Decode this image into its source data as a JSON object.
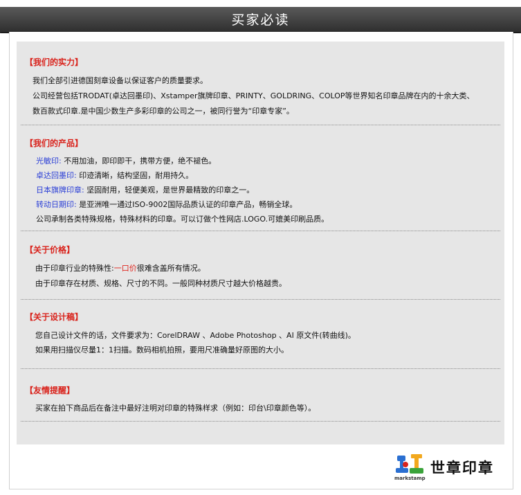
{
  "header": {
    "title": "买家必读"
  },
  "sections": {
    "strength": {
      "title": "【我们的实力】",
      "lines": [
        "我们全部引进德国刻章设备以保证客户的质量要求。",
        "公司经营包括TRODAT(卓达回墨印)、Xstamper旗牌印章、PRINTY、GOLDRING、COLOP等世界知名印章品牌在内的十余大类、",
        "数百款式印章.是中国少数生产多彩印章的公司之一，被同行誉为“印章专家”。"
      ]
    },
    "products": {
      "title": "【我们的产品】",
      "items": [
        {
          "name": "光敏印:",
          "desc": "不用加油，即印即干，携带方便，绝不褪色。"
        },
        {
          "name": "卓达回墨印:",
          "desc": "印迹清晰，结构坚固，耐用持久。"
        },
        {
          "name": "日本旗牌印章:",
          "desc": "坚固耐用，轻便美观，是世界最精致的印章之一。"
        },
        {
          "name": "转动日期印:",
          "desc": "是亚洲唯一通过ISO-9002国际品质认证的印章产品，畅销全球。"
        }
      ],
      "note": "公司承制各类特殊规格，特殊材料的印章。可以订做个性网店.LOGO.可媲美印刷品质。"
    },
    "price": {
      "title": "【关于价格】",
      "line1_pre": "由于印章行业的特殊性:",
      "line1_highlight": "一口价",
      "line1_post": "很难含盖所有情况。",
      "line2": "由于印章存在材质、规格、尺寸的不同。一般同种材质尺寸越大价格越贵。"
    },
    "design": {
      "title": "【关于设计稿】",
      "lines": [
        "您自己设计文件的话，文件要求为：CorelDRAW 、Adobe Photoshop 、AI 原文件(转曲线)。",
        "如果用扫描仪尽量1：1扫描。数码相机拍照，要用尺准确量好原图的大小。"
      ]
    },
    "reminder": {
      "title": "【友情提醒】",
      "line": "买家在拍下商品后在备注中最好注明对印章的特殊样求（例如：印台\\印章颜色等）。"
    }
  },
  "logo": {
    "text": "世章印章",
    "sub": "markstamp"
  },
  "colors": {
    "header_bg": "#3f3f3f",
    "title_red": "#d9231c",
    "link_blue": "#2b3fd6",
    "panel_bg": "#e6e6e6"
  },
  "icons": {
    "logo": "stamp-logo-icon"
  }
}
